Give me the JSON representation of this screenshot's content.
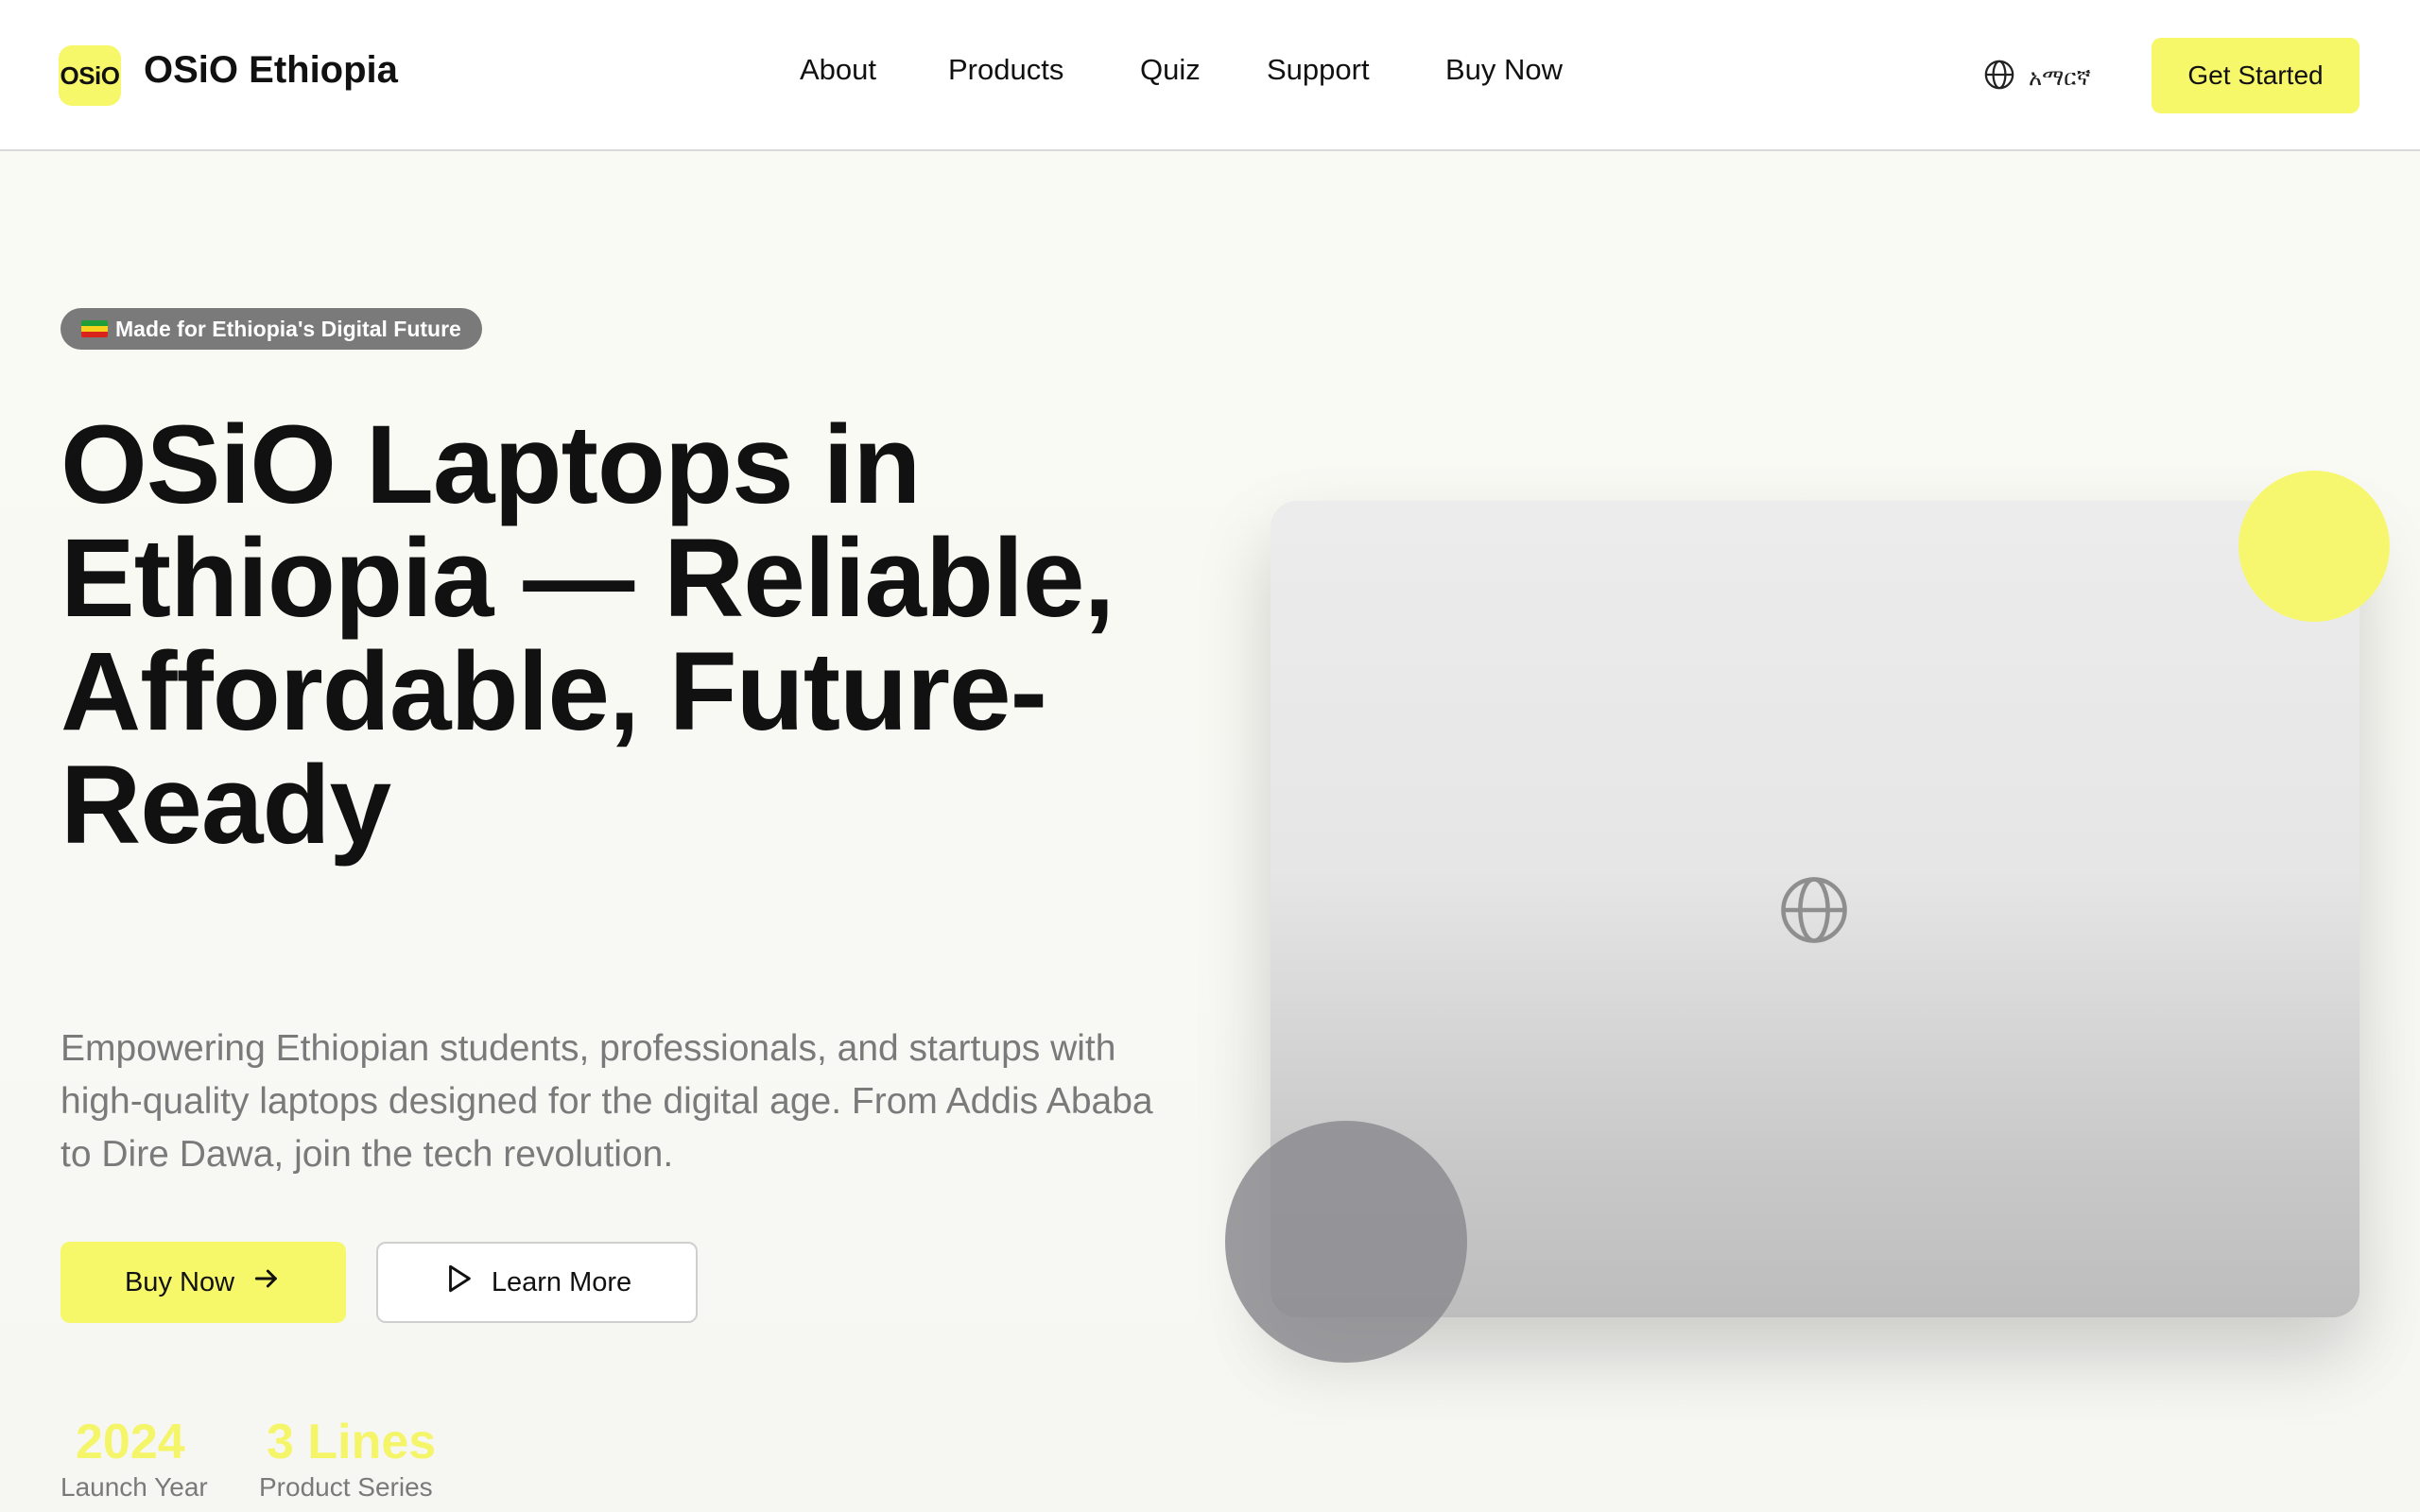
{
  "header": {
    "logo_text": "OSiO",
    "brand_name": "OSiO Ethiopia",
    "nav": [
      "About",
      "Products",
      "Quiz",
      "Support",
      "Buy Now"
    ],
    "language_label": "አማርኛ",
    "cta_label": "Get Started"
  },
  "hero": {
    "badge_text": "Made for Ethiopia's Digital Future",
    "headline": "OSiO Laptops in Ethiopia — Reliable, Affordable, Future-Ready",
    "subtext": "Empowering Ethiopian students, professionals, and startups with high-quality laptops designed for the digital age. From Addis Ababa to Dire Dawa, join the tech revolution.",
    "primary_button": "Buy Now",
    "secondary_button": "Learn More",
    "stats": [
      {
        "value": "2024",
        "label": "Launch Year"
      },
      {
        "value": "3 Lines",
        "label": "Product Series"
      }
    ]
  },
  "icons": {
    "language": "globe-icon",
    "primary_button": "arrow-right-icon",
    "secondary_button": "play-icon",
    "laptop_lid": "globe-icon",
    "badge": "ethiopia-flag-icon"
  },
  "colors": {
    "accent_yellow": "#f7f76a",
    "text_dark": "#111111",
    "text_muted": "#7a7a7a",
    "badge_bg": "#7a7a7a",
    "stat_yellow": "#f5f56a",
    "decor_gray": "#8c8c91"
  }
}
